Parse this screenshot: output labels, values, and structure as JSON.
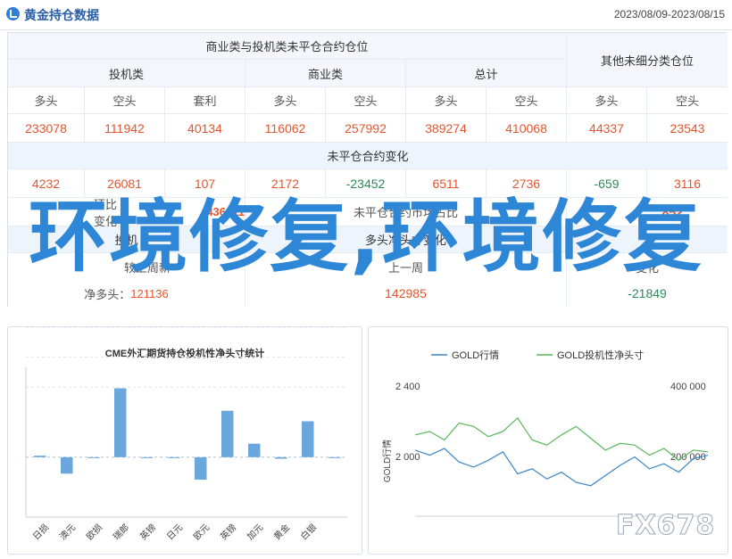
{
  "header": {
    "title": "黄金持仓数据",
    "date_range": "2023/08/09-2023/08/15"
  },
  "table": {
    "group_title": "商业类与投机类未平仓合约仓位",
    "other_title": "其他未细分类仓位",
    "groups": [
      "投机类",
      "商业类",
      "总计"
    ],
    "col_heads": [
      "多头",
      "空头",
      "套利",
      "多头",
      "空头",
      "多头",
      "空头",
      "多头",
      "空头"
    ],
    "values": [
      "233078",
      "111942",
      "40134",
      "116062",
      "257992",
      "389274",
      "410068",
      "44337",
      "23543"
    ],
    "change_title": "未平仓合约变化",
    "changes": [
      "4232",
      "26081",
      "107",
      "2172",
      "-23452",
      "6511",
      "2736",
      "-659",
      "3116"
    ],
    "row3_left": "环比变化",
    "row3_left_val": "436611",
    "row3_mid": "未平仓合约市场占比",
    "row3_right_val": "852",
    "row4_left": "投机",
    "row4_mid": "多头净头寸变化",
    "row5_left_label": "较上周新",
    "row5_mid_label": "上一周",
    "row5_right_label": "变化",
    "net_long_label": "净多头：",
    "net_long_val": "121136",
    "mid_val": "142985",
    "right_val": "-21849"
  },
  "chart_left": {
    "title": "CME外汇期货持仓投机性净头寸统计"
  },
  "chart_right": {
    "legend_gold": "GOLD行情",
    "legend_net": "GOLD投机性净头寸",
    "ylabel": "GOLD行情",
    "y_left_ticks": [
      "2 400",
      "2 000"
    ],
    "y_right_ticks": [
      "400 000",
      "200 000"
    ],
    "gold_color": "#3a86c8",
    "net_color": "#59b85a"
  },
  "chart_data": [
    {
      "type": "bar",
      "title": "CME外汇期货持仓投机性净头寸统计",
      "categories": [
        "日损",
        "澳元",
        "欧损",
        "瑞郎",
        "英镑",
        "日元",
        "欧元",
        "英镑",
        "加元",
        "黄金",
        "白银"
      ],
      "values": [
        1,
        -11,
        0,
        46,
        0,
        0,
        -15,
        31,
        9,
        -1,
        24,
        0
      ],
      "ylim": [
        -40,
        60
      ]
    },
    {
      "type": "line",
      "series": [
        {
          "name": "GOLD行情",
          "values": [
            2090,
            2060,
            2100,
            2020,
            1990,
            2030,
            2080,
            1950,
            1980,
            1920,
            1960,
            1900,
            1880,
            1940,
            2000,
            2050,
            1980,
            2010,
            1960,
            2040,
            2060
          ]
        },
        {
          "name": "GOLD投机性净头寸",
          "values": [
            2180,
            2200,
            2150,
            2250,
            2230,
            2170,
            2200,
            2280,
            2150,
            2120,
            2180,
            2230,
            2160,
            2090,
            2130,
            2120,
            2060,
            2100,
            2030,
            2090,
            2080
          ]
        }
      ],
      "ylim": [
        1700,
        2500
      ]
    }
  ],
  "overlay_text": "环境修复,环境修复",
  "watermark": "FX678"
}
